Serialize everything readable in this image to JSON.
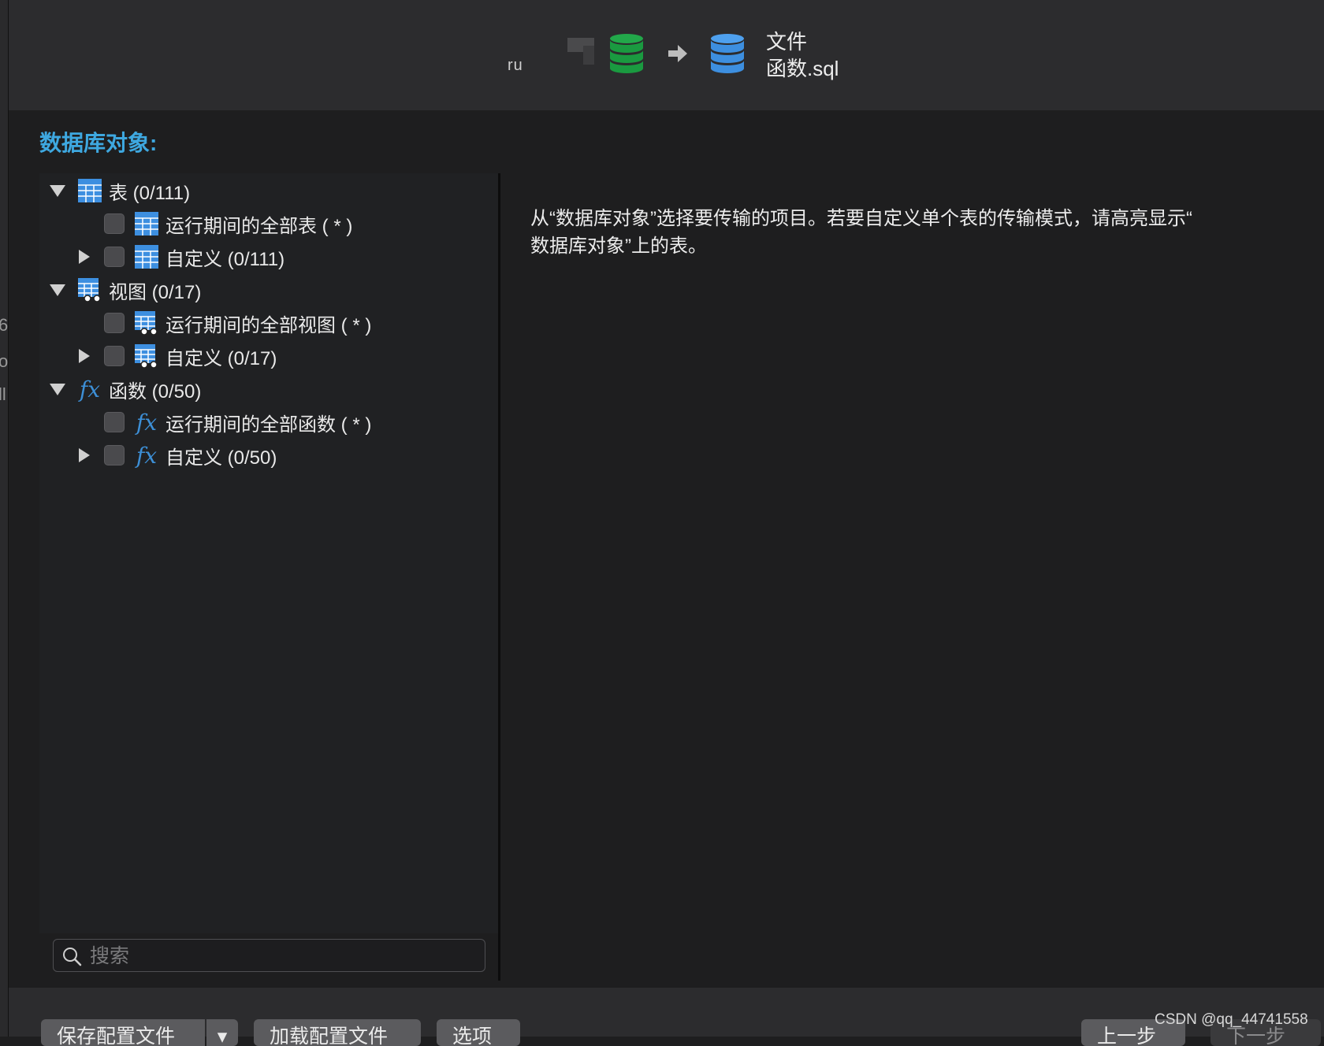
{
  "header": {
    "source_name": "ru",
    "destination_label_line1": "文件",
    "destination_label_line2": "函数.sql",
    "source_db_color": "#1fa14a",
    "destination_db_color": "#3d8fe0"
  },
  "left_edge_chars": [
    "6",
    "o",
    "ll"
  ],
  "section": {
    "title": "数据库对象:"
  },
  "tree": {
    "tables": {
      "label": "表 (0/111)",
      "all_label": "运行期间的全部表 ( * )",
      "custom_label": "自定义 (0/111)",
      "icon": "table-icon"
    },
    "views": {
      "label": "视图 (0/17)",
      "all_label": "运行期间的全部视图 ( * )",
      "custom_label": "自定义 (0/17)",
      "icon": "view-icon"
    },
    "functions": {
      "label": "函数 (0/50)",
      "all_label": "运行期间的全部函数 ( * )",
      "custom_label": "自定义 (0/50)",
      "icon": "function-icon",
      "glyph": "fx"
    }
  },
  "search": {
    "placeholder": "搜索"
  },
  "description": {
    "line1": "从“数据库对象”选择要传输的项目。若要自定义单个表的传输模式，请高亮显示“",
    "line2": "数据库对象”上的表。"
  },
  "footer": {
    "save_profile": "保存配置文件",
    "save_profile_menu": "▾",
    "load_profile": "加载配置文件",
    "options": "选项",
    "previous": "上一步",
    "next": "下一步"
  },
  "watermark": "CSDN @qq_44741558",
  "colors": {
    "accent": "#3ea8e0",
    "background": "#1e1e1f",
    "header": "#2c2c2e"
  }
}
